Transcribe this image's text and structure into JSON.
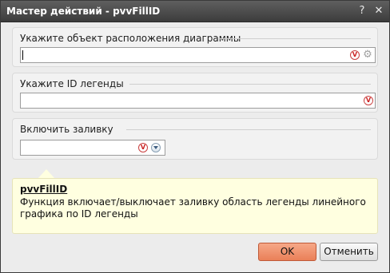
{
  "window": {
    "title": "Мастер действий - pvvFillID",
    "help_glyph": "?",
    "close_glyph": "✕"
  },
  "sections": [
    {
      "label": "Укажите объект расположения диаграммы",
      "value": ""
    },
    {
      "label": "Укажите ID легенды",
      "value": ""
    },
    {
      "label": "Включить заливку",
      "value": ""
    }
  ],
  "icons": {
    "validate_glyph": "V",
    "picker_glyph": "⚙"
  },
  "help": {
    "title": "pvvFillID",
    "description": "Функция включает/выключает заливку область легенды линейного графика по ID легенды"
  },
  "buttons": {
    "ok": "OK",
    "cancel": "Отменить"
  },
  "colors": {
    "titlebar": "#4a4a4a",
    "ok_button": "#ef906c",
    "help_background": "#ffffe0",
    "validate_red": "#c22222"
  }
}
